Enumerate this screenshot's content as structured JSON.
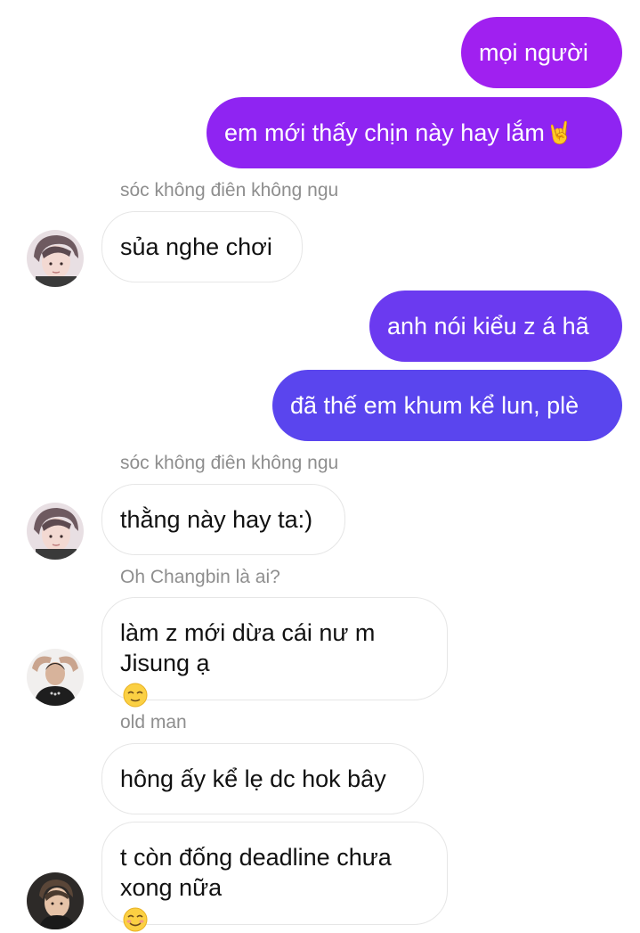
{
  "conversation": {
    "messages": [
      {
        "direction": "outgoing",
        "text": "mọi người",
        "color": "#a020f0"
      },
      {
        "direction": "outgoing",
        "text": "em mới thấy chịn này hay lắm",
        "emoji": "🤘",
        "color": "#8f24f2"
      },
      {
        "direction": "incoming",
        "sender": "sóc không điên không ngu",
        "text": "sủa nghe chơi"
      },
      {
        "direction": "outgoing",
        "text": "anh nói kiểu z á hã",
        "color": "#6b3af0"
      },
      {
        "direction": "outgoing",
        "text": "đã thế em khum kể lun, plè",
        "color": "#5a45ee"
      },
      {
        "direction": "incoming",
        "sender": "sóc không điên không ngu",
        "text": "thằng này hay ta:)"
      },
      {
        "direction": "incoming",
        "sender": "Oh Changbin là ai?",
        "text_lines": [
          "làm z mới dừa cái nư m",
          "Jisung ạ"
        ],
        "emoji": "😌"
      },
      {
        "direction": "incoming",
        "sender": "old man",
        "text": "hông ấy kể lẹ dc hok bây"
      },
      {
        "direction": "incoming",
        "text_lines": [
          "t còn đống deadline chưa",
          "xong nữa"
        ],
        "emoji": "☺️"
      }
    ]
  },
  "avatars": {
    "squirrel": "avatar-sóc",
    "changbin": "avatar-changbin",
    "oldman": "avatar-oldman"
  }
}
